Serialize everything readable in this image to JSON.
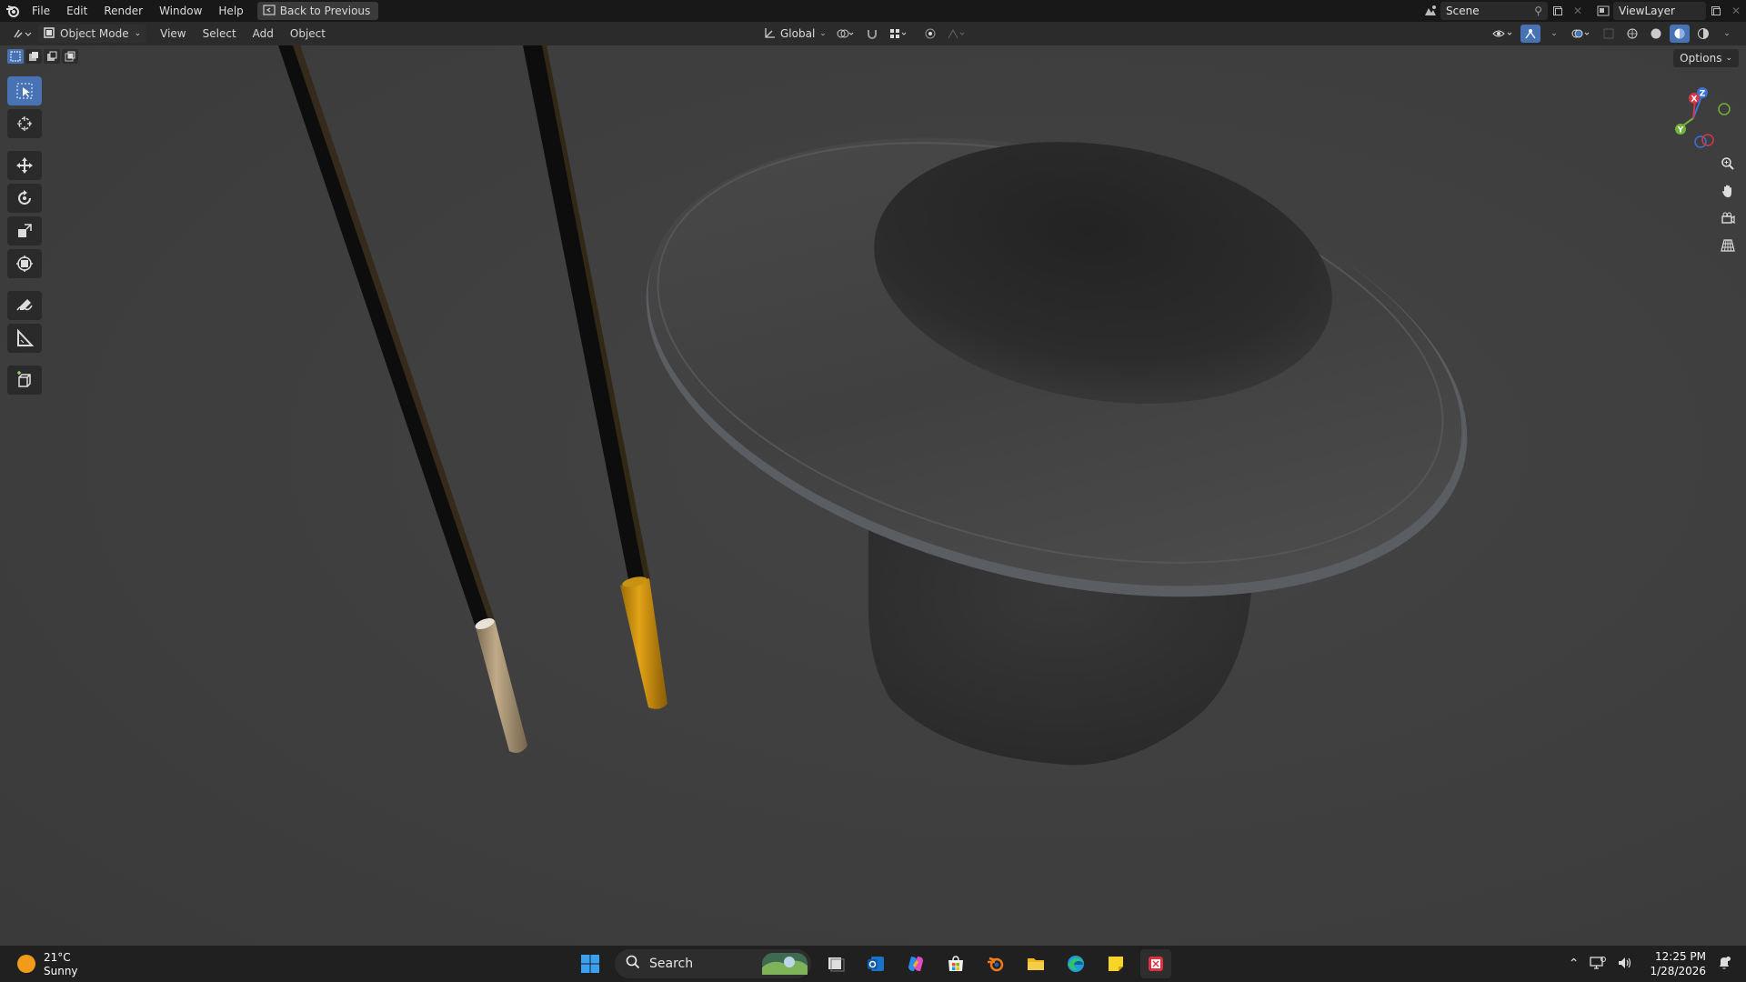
{
  "menubar": {
    "items": [
      "File",
      "Edit",
      "Render",
      "Window",
      "Help"
    ],
    "back_button": "Back to Previous",
    "scene_name": "Scene",
    "view_layer": "ViewLayer"
  },
  "header": {
    "mode": "Object Mode",
    "menus": [
      "View",
      "Select",
      "Add",
      "Object"
    ],
    "transform_orientation": "Global"
  },
  "viewport": {
    "options_label": "Options",
    "gizmo_axes": {
      "x": "X",
      "y": "Y",
      "z": "Z"
    },
    "tools": [
      "select-box",
      "cursor",
      "move",
      "rotate",
      "scale",
      "transform",
      "annotate",
      "measure",
      "add-cube"
    ],
    "nav_buttons": [
      "zoom",
      "pan",
      "camera",
      "perspective-toggle"
    ]
  },
  "taskbar": {
    "weather_temp": "21°C",
    "weather_desc": "Sunny",
    "search_placeholder": "Search",
    "time": "12:25 PM",
    "date": "1/28/2026"
  },
  "colors": {
    "accent": "#4772b3",
    "viewport_bg": "#3d3d3d",
    "topbar_bg": "#181818",
    "header_bg": "#2b2b2b",
    "wand_gold": "#d4960c",
    "wand_silver": "#b09a7a"
  }
}
